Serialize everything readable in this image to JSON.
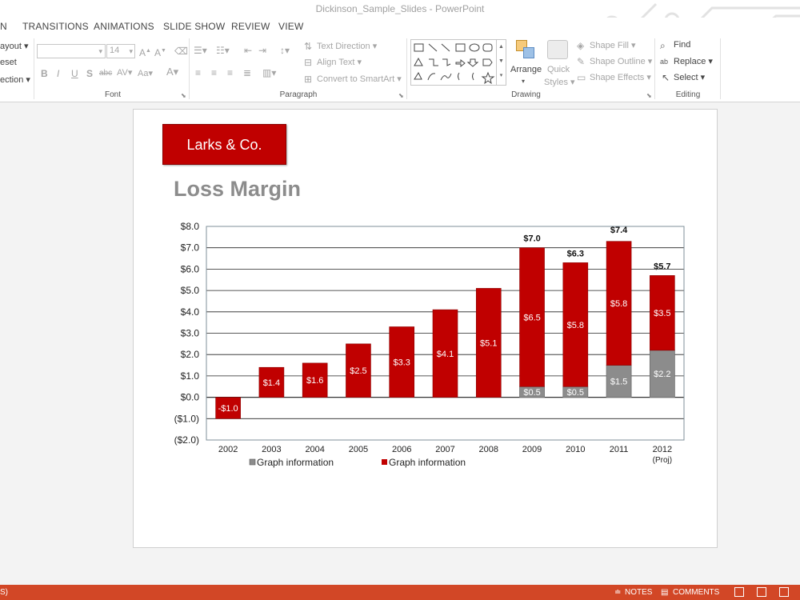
{
  "window": {
    "title": "Dickinson_Sample_Slides - PowerPoint"
  },
  "tabs": [
    {
      "label": "N"
    },
    {
      "label": "TRANSITIONS"
    },
    {
      "label": "ANIMATIONS"
    },
    {
      "label": "SLIDE SHOW"
    },
    {
      "label": "REVIEW"
    },
    {
      "label": "VIEW"
    }
  ],
  "ribbon": {
    "slides": {
      "layout": "ayout",
      "reset": "eset",
      "section": "ection"
    },
    "font": {
      "size": "14",
      "label": "Font"
    },
    "paragraph": {
      "text_direction": "Text Direction",
      "align_text": "Align Text",
      "convert": "Convert to SmartArt",
      "label": "Paragraph"
    },
    "drawing": {
      "arrange": "Arrange",
      "quick_styles_1": "Quick",
      "quick_styles_2": "Styles",
      "shape_fill": "Shape Fill",
      "shape_outline": "Shape Outline",
      "shape_effects": "Shape Effects",
      "label": "Drawing"
    },
    "editing": {
      "find": "Find",
      "replace": "Replace",
      "select": "Select",
      "label": "Editing"
    }
  },
  "slide": {
    "logo": "Larks & Co.",
    "title": "Loss Margin"
  },
  "chart_data": {
    "type": "bar",
    "stacked": true,
    "categories": [
      "2002",
      "2003",
      "2004",
      "2005",
      "2006",
      "2007",
      "2008",
      "2009",
      "2010",
      "2011",
      "2012"
    ],
    "category_sublabels": {
      "2012": "(Proj)"
    },
    "series": [
      {
        "name": "Graph information",
        "color": "#8c8c8c",
        "values": [
          0,
          0,
          0,
          0,
          0,
          0,
          0,
          0.5,
          0.5,
          1.5,
          2.2
        ],
        "labels": [
          "",
          "",
          "",
          "",
          "",
          "",
          "",
          "$0.5",
          "$0.5",
          "$1.5",
          "$2.2"
        ]
      },
      {
        "name": "Graph information",
        "color": "#c00000",
        "values": [
          -1.0,
          1.4,
          1.6,
          2.5,
          3.3,
          4.1,
          5.1,
          6.5,
          5.8,
          5.8,
          3.5
        ],
        "labels": [
          "-$1.0",
          "$1.4",
          "$1.6",
          "$2.5",
          "$3.3",
          "$4.1",
          "$5.1",
          "$6.5",
          "$5.8",
          "$5.8",
          "$3.5"
        ]
      }
    ],
    "totals": [
      "",
      "",
      "",
      "",
      "",
      "",
      "",
      "$7.0",
      "$6.3",
      "$7.4",
      "$5.7"
    ],
    "total_values": [
      0,
      0,
      0,
      0,
      0,
      0,
      0,
      7.0,
      6.3,
      7.4,
      5.7
    ],
    "yticks": [
      "$8.0",
      "$7.0",
      "$6.0",
      "$5.0",
      "$4.0",
      "$3.0",
      "$2.0",
      "$1.0",
      "$0.0",
      "($1.0)",
      "($2.0)"
    ],
    "ylim": [
      -2,
      8
    ],
    "grid": true,
    "legend": "bottom",
    "xlabel": "",
    "ylabel": ""
  },
  "statusbar": {
    "left": "S)",
    "notes": "NOTES",
    "comments": "COMMENTS"
  }
}
